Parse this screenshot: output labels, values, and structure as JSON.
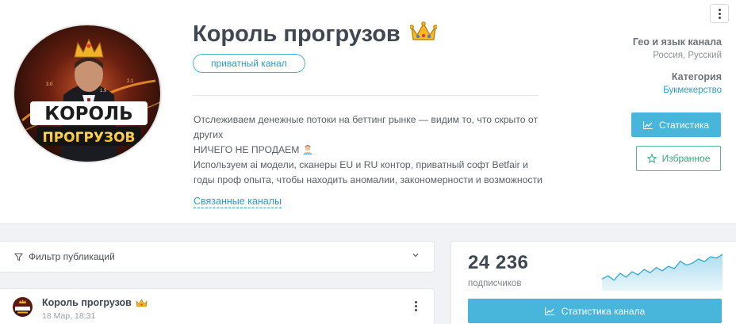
{
  "channel": {
    "title": "Король прогрузов",
    "title_emoji": "crown-emoji",
    "badge": "приватный канал",
    "description": [
      "Отслеживаем денежные потоки на беттинг рынке — видим то, что скрыто от",
      "других",
      "НИЧЕГО НЕ ПРОДАЕМ",
      "Используем ai модели, сканеры EU и RU контор, приватный софт Betfair и",
      "годы проф опыта, чтобы находить аномалии, закономерности и возможности"
    ],
    "related_link": "Связанные каналы",
    "avatar_text": [
      "КОРОЛЬ",
      "ПРОГРУЗОВ"
    ],
    "avatar_chart_labels": [
      "3.0",
      "1.9",
      "2.1"
    ]
  },
  "side": {
    "geo_label": "Гео и язык канала",
    "geo_value": "Россия, Русский",
    "category_label": "Категория",
    "category_value": "Букмекерство",
    "stats_button": "Статистика",
    "favorite_button": "Избранное"
  },
  "filter": {
    "label": "Фильтр публикаций"
  },
  "post": {
    "author": "Король прогрузов",
    "date": "18 Мар, 18:31"
  },
  "stats": {
    "subscribers_count": "24 236",
    "subscribers_label": "подписчиков",
    "button": "Статистика канала",
    "sparkline_trend": [
      0.22,
      0.32,
      0.18,
      0.4,
      0.28,
      0.45,
      0.35,
      0.52,
      0.42,
      0.58,
      0.48,
      0.62,
      0.55,
      0.78,
      0.66,
      0.72,
      0.85,
      0.77,
      0.92,
      0.88,
      1.0
    ]
  },
  "colors": {
    "accent": "#48b5db",
    "favorite": "#3aa77a",
    "title": "#3f4752"
  }
}
